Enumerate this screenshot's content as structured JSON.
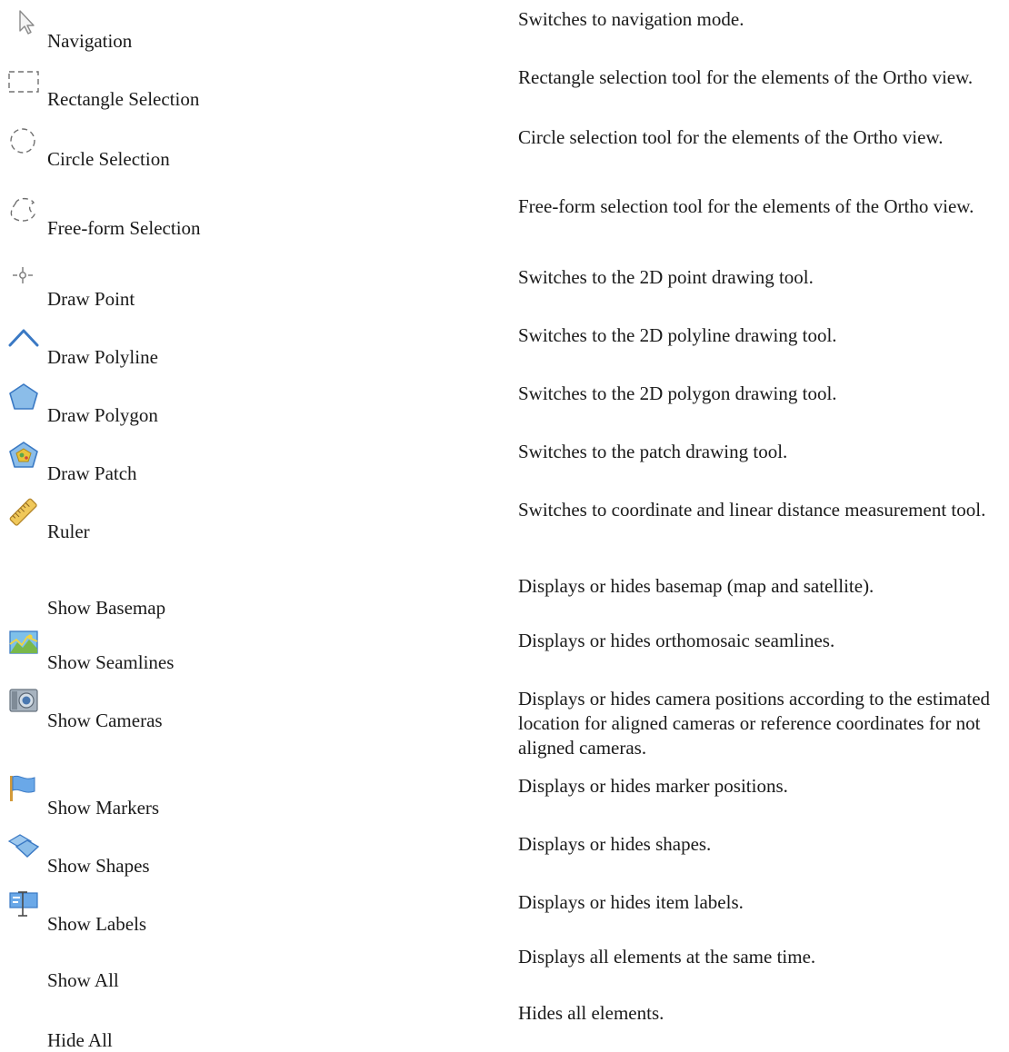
{
  "tools": [
    {
      "label": "Navigation",
      "icon": "cursor-arrow-icon",
      "description": "Switches to navigation mode."
    },
    {
      "label": "Rectangle Selection",
      "icon": "rectangle-selection-icon",
      "description": "Rectangle selection tool for the elements of the Ortho view."
    },
    {
      "label": "Circle Selection",
      "icon": "circle-selection-icon",
      "description": "Circle selection tool for the elements of the Ortho view."
    },
    {
      "label": "Free-form Selection",
      "icon": "freeform-selection-icon",
      "description": "Free-form selection tool for the elements of the Ortho view."
    },
    {
      "label": "Draw Point",
      "icon": "draw-point-icon",
      "description": "Switches to the 2D point drawing tool."
    },
    {
      "label": "Draw Polyline",
      "icon": "draw-polyline-icon",
      "description": "Switches to the 2D polyline drawing tool."
    },
    {
      "label": "Draw Polygon",
      "icon": "draw-polygon-icon",
      "description": "Switches to the 2D polygon drawing tool."
    },
    {
      "label": "Draw Patch",
      "icon": "draw-patch-icon",
      "description": "Switches to the patch drawing tool."
    },
    {
      "label": "Ruler",
      "icon": "ruler-icon",
      "description": "Switches to coordinate and linear distance measurement tool."
    },
    {
      "label": "Show Basemap",
      "icon": "",
      "description": "Displays or hides basemap (map and satellite)."
    },
    {
      "label": "Show Seamlines",
      "icon": "seamlines-icon",
      "description": "Displays or hides orthomosaic seamlines."
    },
    {
      "label": "Show Cameras",
      "icon": "camera-icon",
      "description": "Displays or hides camera positions according to the estimated location for aligned cameras or reference coordinates for not aligned cameras."
    },
    {
      "label": "Show Markers",
      "icon": "marker-flag-icon",
      "description": "Displays or hides marker positions."
    },
    {
      "label": "Show Shapes",
      "icon": "shapes-icon",
      "description": "Displays or hides shapes."
    },
    {
      "label": "Show Labels",
      "icon": "labels-icon",
      "description": "Displays or hides item labels."
    },
    {
      "label": "Show All",
      "icon": "",
      "description": "Displays all elements at the same time."
    },
    {
      "label": "Hide All",
      "icon": "",
      "description": "Hides all elements."
    }
  ]
}
